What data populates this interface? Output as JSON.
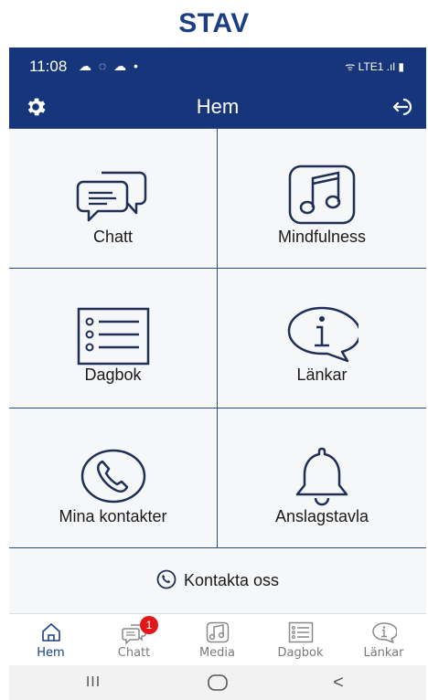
{
  "app": {
    "title": "STAV"
  },
  "status_bar": {
    "time": "11:08",
    "left_icons": "☁ ◌ ☁ •",
    "right_icons": "ᯤ LTE1 .ıl ▮"
  },
  "header": {
    "title": "Hem",
    "settings_icon": "gear-icon",
    "logout_icon": "logout-icon"
  },
  "tiles": [
    {
      "label": "Chatt",
      "icon": "chat-bubbles-icon"
    },
    {
      "label": "Mindfulness",
      "icon": "music-note-icon"
    },
    {
      "label": "Dagbok",
      "icon": "list-icon"
    },
    {
      "label": "Länkar",
      "icon": "info-bubble-icon"
    },
    {
      "label": "Mina kontakter",
      "icon": "phone-icon"
    },
    {
      "label": "Anslagstavla",
      "icon": "bell-icon"
    }
  ],
  "contact": {
    "label": "Kontakta oss",
    "icon": "phone-icon"
  },
  "bottom_nav": {
    "items": [
      {
        "label": "Hem",
        "icon": "home-icon",
        "active": true
      },
      {
        "label": "Chatt",
        "icon": "chat-icon",
        "badge": "1"
      },
      {
        "label": "Media",
        "icon": "music-note-icon"
      },
      {
        "label": "Dagbok",
        "icon": "list-icon"
      },
      {
        "label": "Länkar",
        "icon": "info-icon"
      }
    ]
  },
  "system_nav": {
    "recents_glyph": "III",
    "back_glyph": "<"
  },
  "colors": {
    "brand": "#17357a",
    "title": "#1b3f82",
    "badge": "#e2171a"
  }
}
